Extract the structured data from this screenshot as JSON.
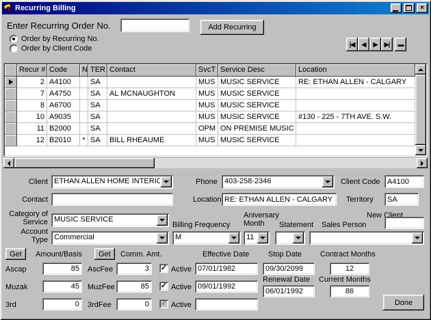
{
  "window": {
    "title": "Recurring Billing"
  },
  "icons": {
    "close": "×",
    "check": "✓",
    "nav_first": "|◀",
    "nav_prev": "◀",
    "nav_next": "▶",
    "nav_last": "▶|",
    "nav_delete": "▬"
  },
  "top": {
    "order_no_label": "Enter Recurring Order No.",
    "order_no_value": "",
    "add_button": "Add Recurring",
    "radio_recurring_label": "Order by Recurring No.",
    "radio_client_label": "Order by Client Code",
    "radio_selected": "Order by Recurring No."
  },
  "grid": {
    "columns": [
      "Recur #",
      "Code",
      "N",
      "TER",
      "Contact",
      "SvcT",
      "Service Desc",
      "Location"
    ],
    "rows": [
      {
        "recur": "2",
        "code": "A4100",
        "n": "",
        "ter": "SA",
        "contact": "",
        "svct": "MUS",
        "desc": "MUSIC SERVICE",
        "loc": "RE: ETHAN ALLEN - CALGARY"
      },
      {
        "recur": "7",
        "code": "A4750",
        "n": "",
        "ter": "SA",
        "contact": "AL MCNAUGHTON",
        "svct": "MUS",
        "desc": "MUSIC SERVICE",
        "loc": ""
      },
      {
        "recur": "8",
        "code": "A6700",
        "n": "",
        "ter": "SA",
        "contact": "",
        "svct": "MUS",
        "desc": "MUSIC SERVICE",
        "loc": ""
      },
      {
        "recur": "10",
        "code": "A9035",
        "n": "",
        "ter": "SA",
        "contact": "",
        "svct": "MUS",
        "desc": "MUSIC SERVICE",
        "loc": "#130 - 225 - 7TH AVE. S.W."
      },
      {
        "recur": "11",
        "code": "B2000",
        "n": "",
        "ter": "SA",
        "contact": "",
        "svct": "OPM",
        "desc": "ON PREMISE MUSIC",
        "loc": ""
      },
      {
        "recur": "12",
        "code": "B2010",
        "n": "*",
        "ter": "SA",
        "contact": "BILL RHEAUME",
        "svct": "MUS",
        "desc": "MUSIC SERVICE",
        "loc": ""
      }
    ]
  },
  "form": {
    "client_label": "Client",
    "client_value": "ETHAN ALLEN HOME INTERIC",
    "phone_label": "Phone",
    "phone_value": "403-258-2346",
    "client_code_label": "Client Code",
    "client_code_value": "A4100",
    "contact_label": "Contact",
    "contact_value": "",
    "location_label": "Location",
    "location_value": "RE: ETHAN ALLEN - CALGARY",
    "territory_label": "Territory",
    "territory_value": "SA",
    "category_label": "Category of Service",
    "category_value": "MUSIC SERVICE",
    "billing_frequency_label": "Billing Frequency",
    "billing_frequency_value": "M",
    "anniversary_label": "Aniversary Month",
    "anniversary_value": "11",
    "statement_label": "Statement",
    "statement_value": "",
    "sales_person_label": "Sales Person",
    "sales_person_value": "",
    "new_client_label": "New Client",
    "new_client_value": "",
    "account_type_label": "Account Type",
    "account_type_value": "Commercial",
    "get_button": "Get",
    "amount_basis_label": "Amount/Basis",
    "comm_amt_label": "Comm. Amt.",
    "effective_date_label": "Effective Date",
    "stop_date_label": "Stop Date",
    "contract_months_label": "Contract Months",
    "ascap_label": "Ascap",
    "ascap_value": "85",
    "ascfee_label": "AscFee",
    "ascfee_value": "3",
    "active_label": "Active",
    "effective_ascap": "07/01/1982",
    "stop_date_value": "09/30/2099",
    "contract_months_value": "12",
    "muzak_label": "Muzak",
    "muzak_value": "45",
    "muzfee_label": "MuzFee",
    "muzfee_value": "85",
    "effective_muzak": "09/01/1992",
    "renewal_date_label": "Renewal Date",
    "renewal_date_value": "06/01/1992",
    "current_months_label": "Current Months",
    "current_months_value": "86",
    "third_label": "3rd",
    "third_value": "0",
    "thirdfee_label": "3rdFee",
    "thirdfee_value": "0",
    "effective_third": "",
    "done_button": "Done"
  }
}
